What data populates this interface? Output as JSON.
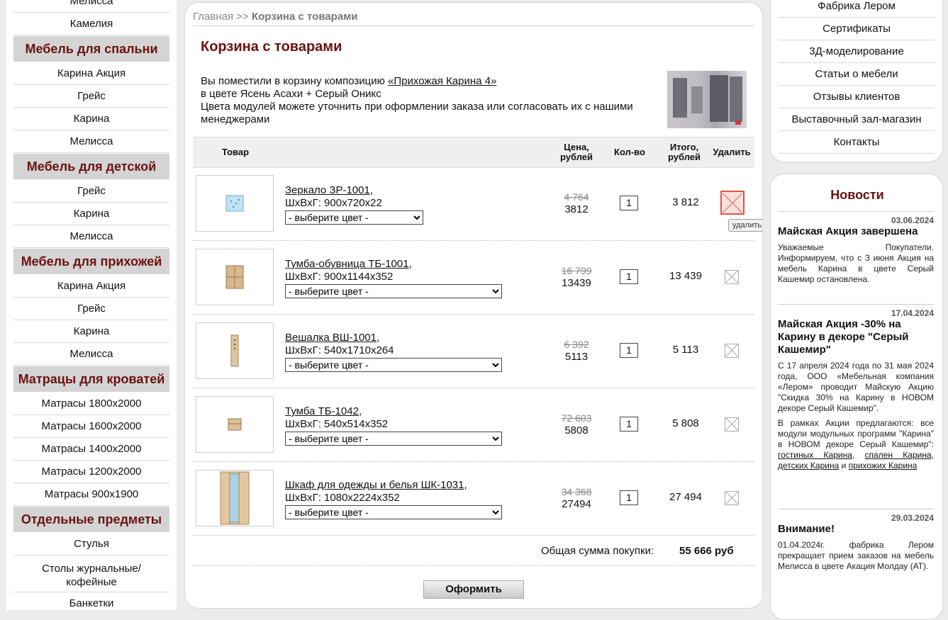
{
  "left_menu": {
    "top_items": [
      "Мелисса",
      "Камелия"
    ],
    "sections": [
      {
        "title": "Мебель для спальни",
        "items": [
          "Карина Акция",
          "Грейс",
          "Карина",
          "Мелисса"
        ]
      },
      {
        "title": "Мебель для детской",
        "items": [
          "Грейс",
          "Карина",
          "Мелисса"
        ]
      },
      {
        "title": "Мебель для прихожей",
        "items": [
          "Карина Акция",
          "Грейс",
          "Карина",
          "Мелисса"
        ]
      },
      {
        "title": "Матрацы для кроватей",
        "items": [
          "Матрасы 1800х2000",
          "Матрасы 1600х2000",
          "Матрасы 1400х2000",
          "Матрасы 1200х2000",
          "Матрасы 900х1900"
        ]
      },
      {
        "title": "Отдельные предметы",
        "items": [
          "Стулья",
          "Столы журнальные/ кофейные",
          "Банкетки"
        ]
      }
    ]
  },
  "breadcrumb": {
    "home": "Главная",
    "sep": ">>",
    "current": "Корзина с товарами"
  },
  "page_title": "Корзина с товарами",
  "intro": {
    "line1_prefix": "Вы поместили в корзину композицию",
    "composition_link": "«Прихожая Карина 4»",
    "line2": "в цвете Ясень Асахи + Серый Оникс",
    "line3": "Цвета модулей можете уточнить при оформлении заказа или согласовать их с нашими менеджерами"
  },
  "table_headers": {
    "product": "Товар",
    "price": "Цена, рублей",
    "qty": "Кол-во",
    "total": "Итого, рублей",
    "delete": "Удалить"
  },
  "products": [
    {
      "name": "Зеркало ЗР-1001",
      "dims": "ШхВхГ: 900х720х22",
      "color_select": "- выберите цвет -",
      "old_price": "4 764",
      "price": "3812",
      "qty": "1",
      "total": "3 812",
      "icon": "mirror-icon"
    },
    {
      "name": "Тумба-обувница ТБ-1001",
      "dims": "ШхВхГ: 900х1144х352",
      "color_select": "- выберите цвет -",
      "old_price": "16 799",
      "price": "13439",
      "qty": "1",
      "total": "13 439",
      "icon": "shoe-cabinet-icon"
    },
    {
      "name": "Вешалка ВШ-1001",
      "dims": "ШхВхГ: 540х1710х264",
      "color_select": "- выберите цвет -",
      "old_price": "6 392",
      "price": "5113",
      "qty": "1",
      "total": "5 113",
      "icon": "hanger-icon"
    },
    {
      "name": "Тумба ТБ-1042",
      "dims": "ШхВхГ: 540х514х352",
      "color_select": "- выберите цвет -",
      "old_price": "72 603",
      "price": "5808",
      "qty": "1",
      "total": "5 808",
      "icon": "nightstand-icon"
    },
    {
      "name": "Шкаф для одежды и белья ШК-1031",
      "dims": "ШхВхГ: 1080х2224х352",
      "color_select": "- выберите цвет -",
      "old_price": "34 368",
      "price": "27494",
      "qty": "1",
      "total": "27 494",
      "icon": "wardrobe-icon"
    }
  ],
  "delete_tooltip": "удалить",
  "summary": {
    "label": "Общая сумма покупки:",
    "value": "55 666 руб"
  },
  "order_button": "Оформить",
  "right_menu": [
    "Фабрика Лером",
    "Сертификаты",
    "3Д-моделирование",
    "Статьи о мебели",
    "Отзывы клиентов",
    "Выставочный зал-магазин",
    "Контакты"
  ],
  "news": {
    "title": "Новости",
    "items": [
      {
        "date": "03.06.2024",
        "headline": "Майская Акция завершена",
        "text": "Уважаемые Покупатели. Информируем, что с 3 июня Акция на мебель Карина в цвете Серый Кашемир остановлена."
      },
      {
        "date": "17.04.2024",
        "headline": "Майская Акция -30% на Карину в декоре \"Серый Кашемир\"",
        "text": "С 17 апреля 2024 года по 31 мая 2024 года, ООО «Мебельная компания «Лером» проводит Майскую Акцию \"Скидка 30% на Карину в НОВОМ декоре Серый Кашемир\".",
        "text2_prefix": "В рамках Акции предлагаются: все модули модульных программ \"Карина\" в НОВОМ декоре Серый Кашемир\":",
        "link1": "гостиных Карина",
        "link2": "спален Карина",
        "link3": "детских Карина",
        "conj": "и",
        "link4": "прихожих Карина"
      },
      {
        "date": "29.03.2024",
        "headline": "Внимание!",
        "text": "01.04.2024г. фабрика Лером прекращает прием заказов на мебель Мелисса в цвете Акация Молдау (АТ)."
      }
    ]
  }
}
